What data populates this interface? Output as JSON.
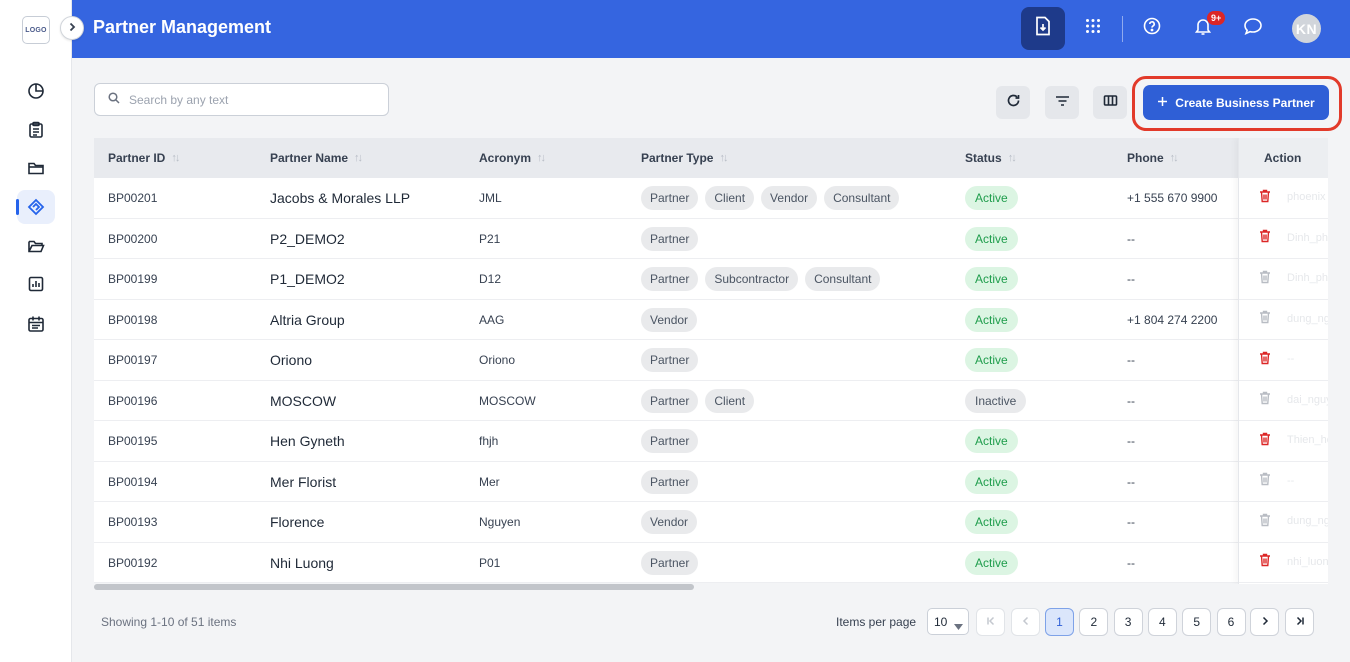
{
  "app": {
    "logo_text": "LOGO",
    "title": "Partner Management"
  },
  "header": {
    "notification_badge": "9+",
    "avatar_initials": "KN"
  },
  "sidebar": {
    "items": [
      {
        "name": "dashboard",
        "icon": "pie-chart-icon"
      },
      {
        "name": "tasks",
        "icon": "clipboard-icon"
      },
      {
        "name": "projects",
        "icon": "folder-icon"
      },
      {
        "name": "partners",
        "icon": "handshake-icon",
        "active": true
      },
      {
        "name": "documents",
        "icon": "folder-open-icon"
      },
      {
        "name": "reports",
        "icon": "bar-chart-icon"
      },
      {
        "name": "calendar",
        "icon": "calendar-icon"
      }
    ]
  },
  "toolbar": {
    "search_placeholder": "Search by any text",
    "create_label": "Create Business Partner"
  },
  "table": {
    "columns": [
      "Partner ID",
      "Partner Name",
      "Acronym",
      "Partner Type",
      "Status",
      "Phone",
      "Action"
    ],
    "rows": [
      {
        "id": "BP00201",
        "name": "Jacobs & Morales LLP",
        "acronym": "JML",
        "types": [
          "Partner",
          "Client",
          "Vendor",
          "Consultant"
        ],
        "status": "Active",
        "phone": "+1 555 670 9900",
        "delete_enabled": true,
        "ghost": "phoenix"
      },
      {
        "id": "BP00200",
        "name": "P2_DEMO2",
        "acronym": "P21",
        "types": [
          "Partner"
        ],
        "status": "Active",
        "phone": "--",
        "delete_enabled": true,
        "ghost": "Dinh_phuong"
      },
      {
        "id": "BP00199",
        "name": "P1_DEMO2",
        "acronym": "D12",
        "types": [
          "Partner",
          "Subcontractor",
          "Consultant"
        ],
        "status": "Active",
        "phone": "--",
        "delete_enabled": false,
        "ghost": "Dinh_phuong"
      },
      {
        "id": "BP00198",
        "name": "Altria Group",
        "acronym": "AAG",
        "types": [
          "Vendor"
        ],
        "status": "Active",
        "phone": "+1 804 274 2200",
        "delete_enabled": false,
        "ghost": "dung_nguyen"
      },
      {
        "id": "BP00197",
        "name": "Oriono",
        "acronym": "Oriono",
        "types": [
          "Partner"
        ],
        "status": "Active",
        "phone": "--",
        "delete_enabled": true,
        "ghost": "--"
      },
      {
        "id": "BP00196",
        "name": "MOSCOW",
        "acronym": "MOSCOW",
        "types": [
          "Partner",
          "Client"
        ],
        "status": "Inactive",
        "phone": "--",
        "delete_enabled": false,
        "ghost": "dai_nguyen"
      },
      {
        "id": "BP00195",
        "name": "Hen Gyneth",
        "acronym": "fhjh",
        "types": [
          "Partner"
        ],
        "status": "Active",
        "phone": "--",
        "delete_enabled": true,
        "ghost": "Thien_ho"
      },
      {
        "id": "BP00194",
        "name": "Mer Florist",
        "acronym": "Mer",
        "types": [
          "Partner"
        ],
        "status": "Active",
        "phone": "--",
        "delete_enabled": false,
        "ghost": "--"
      },
      {
        "id": "BP00193",
        "name": "Florence",
        "acronym": "Nguyen",
        "types": [
          "Vendor"
        ],
        "status": "Active",
        "phone": "--",
        "delete_enabled": false,
        "ghost": "dung_nguyen"
      },
      {
        "id": "BP00192",
        "name": "Nhi Luong",
        "acronym": "P01",
        "types": [
          "Partner"
        ],
        "status": "Active",
        "phone": "--",
        "delete_enabled": true,
        "ghost": "nhi_luong"
      }
    ]
  },
  "footer": {
    "showing_text": "Showing 1-10 of 51 items",
    "items_per_page_label": "Items per page",
    "items_per_page_value": "10",
    "pages": [
      "1",
      "2",
      "3",
      "4",
      "5",
      "6"
    ],
    "current_page": "1"
  },
  "colors": {
    "header": "#3565e0",
    "primary_button": "#2f5fd6",
    "highlight_ring": "#e23a2a",
    "active_status": "#1f9d4c",
    "delete_active": "#dc2626",
    "delete_disabled": "#b8bcc3"
  }
}
